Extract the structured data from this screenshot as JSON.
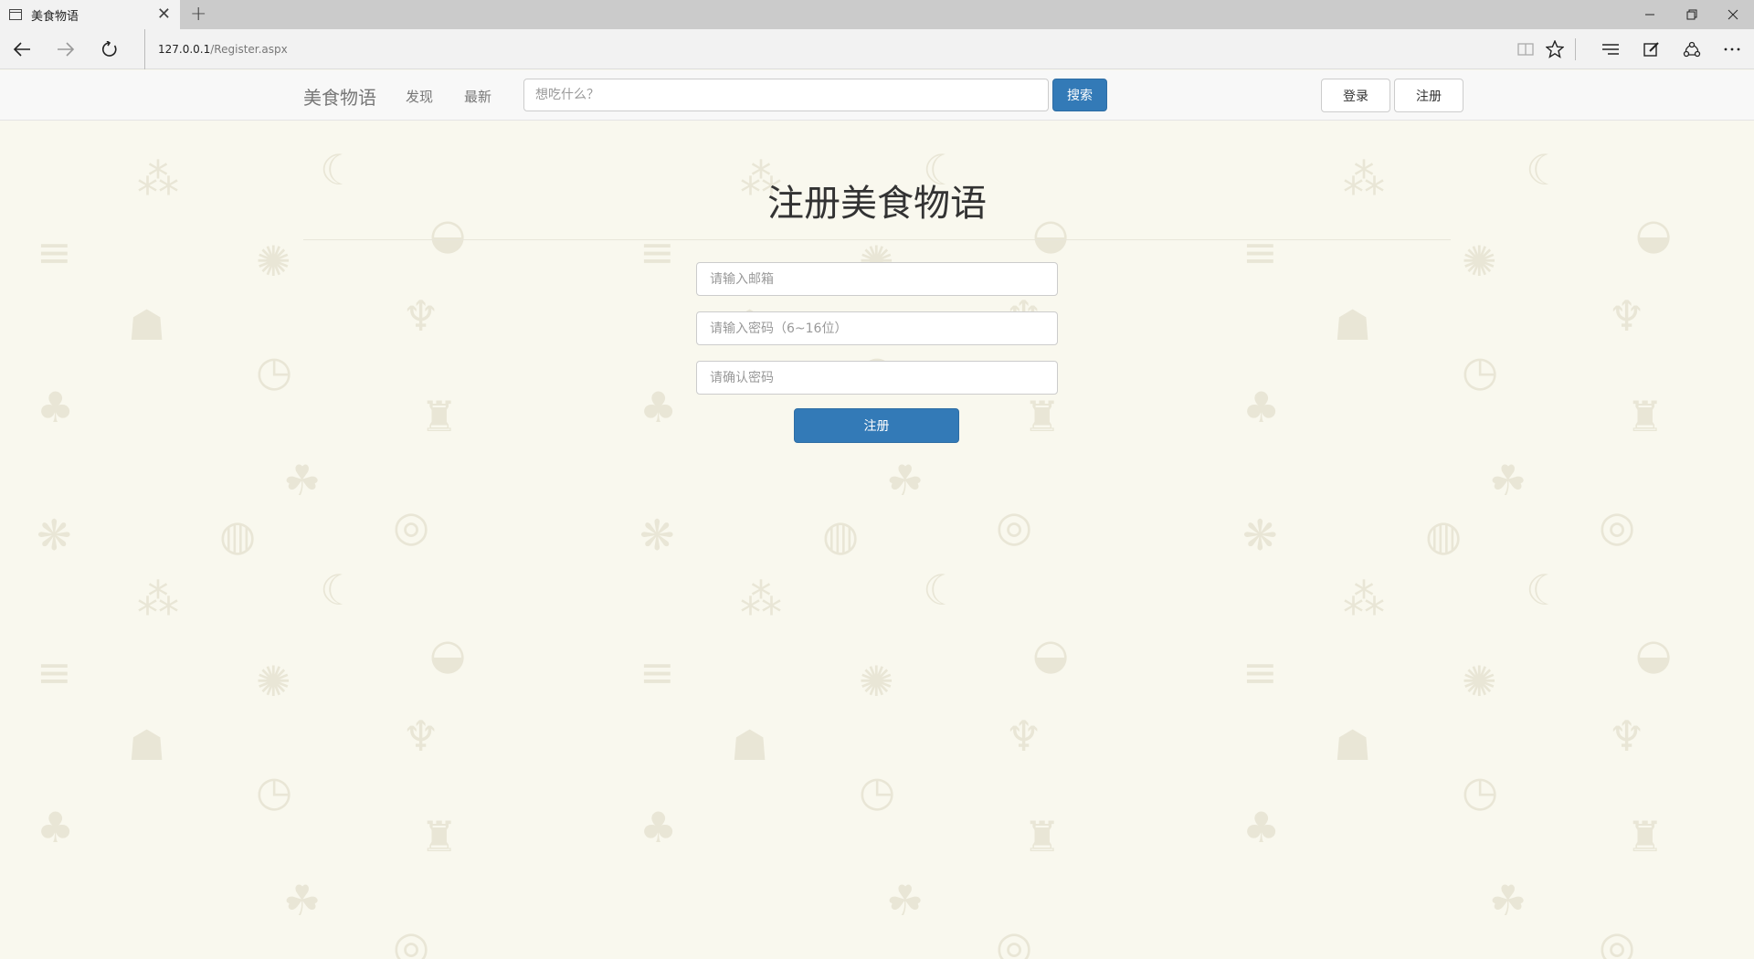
{
  "browser": {
    "tab_title": "美食物语",
    "new_tab_symbol": "+",
    "url_host": "127.0.0.1",
    "url_path": "/Register.aspx"
  },
  "site": {
    "brand": "美食物语",
    "nav": [
      "发现",
      "最新"
    ],
    "search_placeholder": "想吃什么？",
    "search_button": "搜索",
    "login_button": "登录",
    "register_button": "注册"
  },
  "form": {
    "title": "注册美食物语",
    "email_placeholder": "请输入邮箱",
    "password_placeholder": "请输入密码（6~16位）",
    "confirm_placeholder": "请确认密码",
    "submit_label": "注册"
  },
  "colors": {
    "primary": "#337ab7",
    "page_background": "#f9f8ee",
    "pattern_icon": "#e9e6d6"
  },
  "background_icons": [
    "pineapple-icon",
    "watermelon-icon",
    "donut-icon",
    "banana-icon",
    "grapes-icon",
    "steak-icon",
    "asparagus-icon",
    "orange-slice-icon",
    "roast-chicken-icon",
    "cocktail-icon",
    "clock-icon",
    "cherry-icon",
    "grill-icon",
    "broccoli-icon"
  ]
}
